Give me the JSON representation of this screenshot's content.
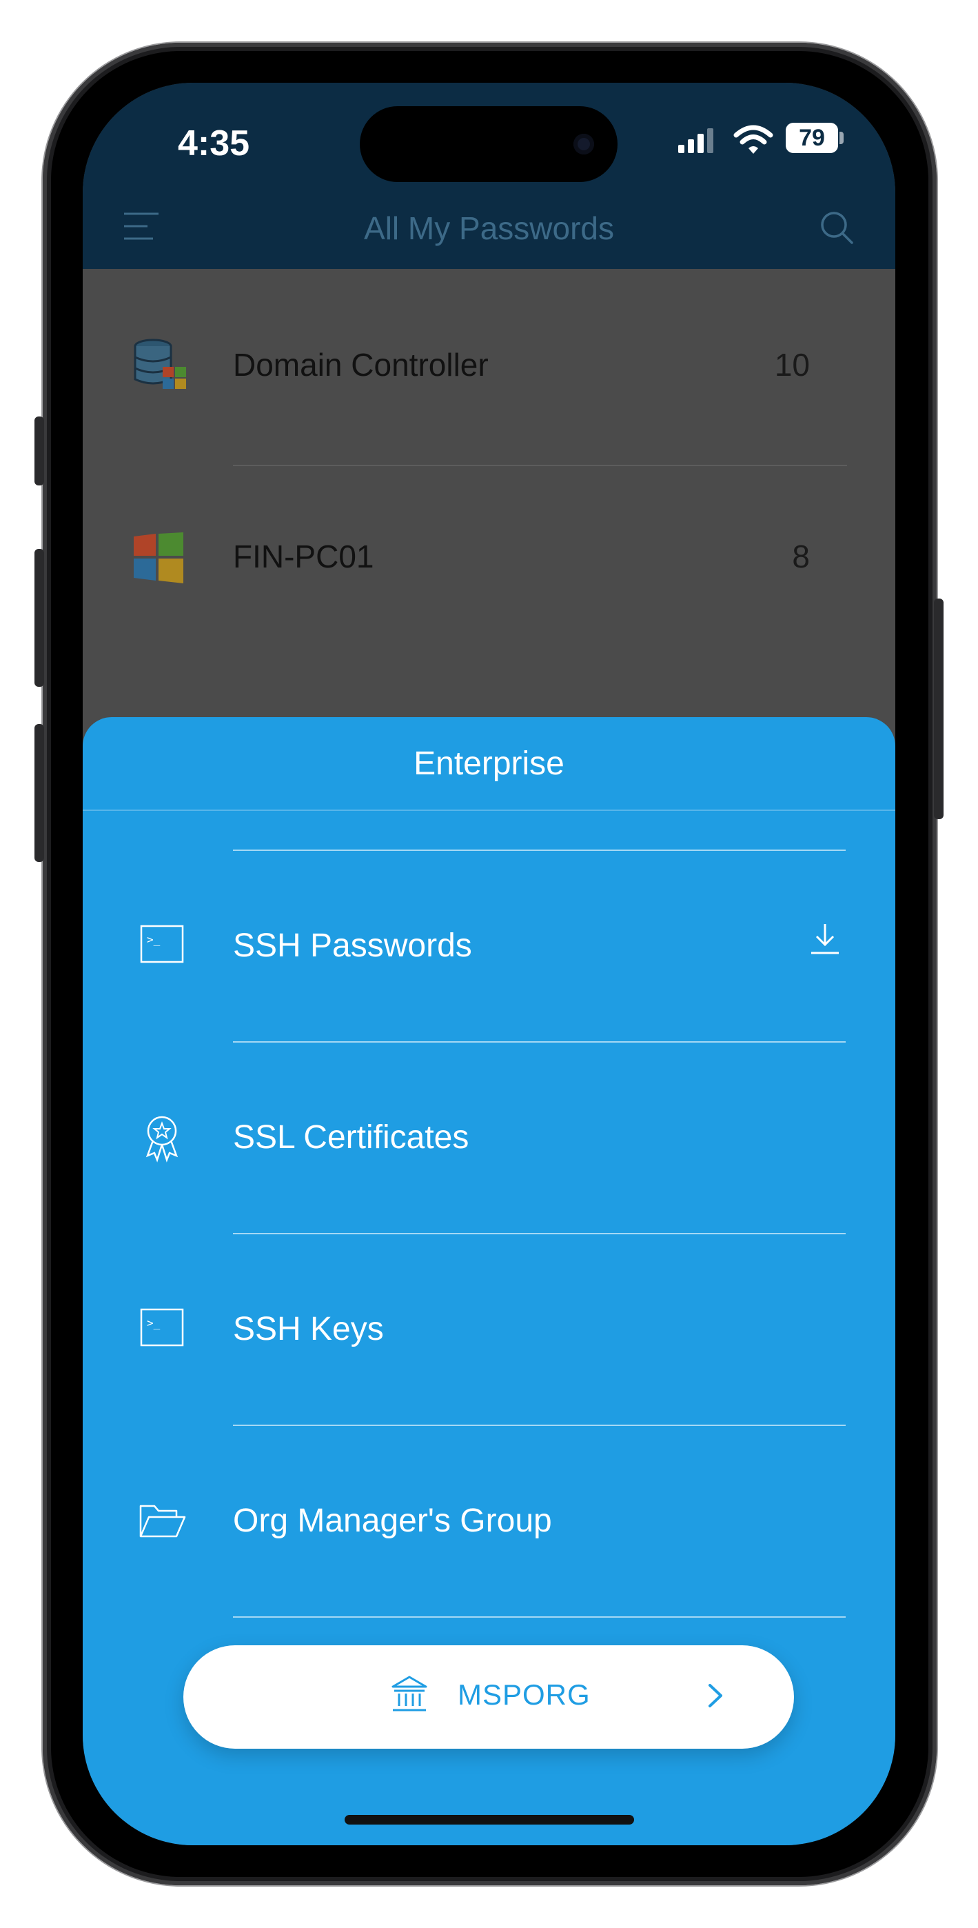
{
  "status_bar": {
    "time": "4:35",
    "battery": "79"
  },
  "header": {
    "title": "All My Passwords",
    "menu_icon": "hamburger-icon",
    "search_icon": "search-icon"
  },
  "list": [
    {
      "label": "Domain Controller",
      "count": "10",
      "icon": "database-windows-icon"
    },
    {
      "label": "FIN-PC01",
      "count": "8",
      "icon": "windows-logo-icon"
    }
  ],
  "sheet": {
    "title": "Enterprise",
    "items": [
      {
        "label": "SSH Passwords",
        "icon": "terminal-icon",
        "trailing_icon": "download-icon"
      },
      {
        "label": "SSL Certificates",
        "icon": "certificate-badge-icon"
      },
      {
        "label": "SSH Keys",
        "icon": "terminal-icon"
      },
      {
        "label": "Org Manager's Group",
        "icon": "folder-open-icon"
      }
    ]
  },
  "org_switcher": {
    "label": "MSPORG",
    "icon": "bank-icon",
    "chevron": "chevron-right-icon"
  },
  "colors": {
    "sheet": "#1f9de3",
    "header": "#0c2c44",
    "overlay": "#4b4b4b"
  }
}
